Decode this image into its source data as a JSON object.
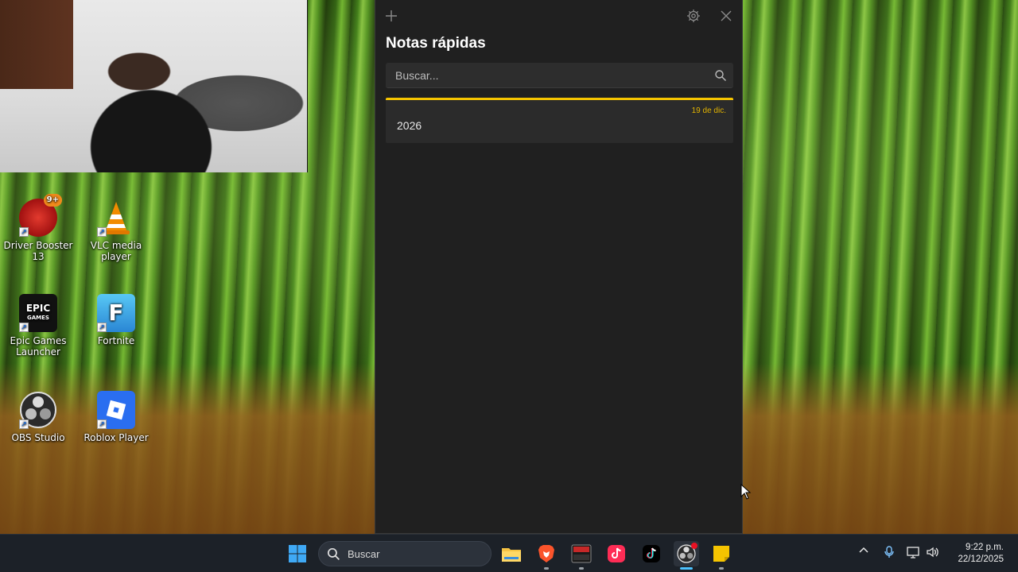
{
  "desktop": {
    "icons": [
      {
        "label": "Driver Booster 13",
        "badge": "9+",
        "color": "#c8201e"
      },
      {
        "label": "VLC media player",
        "color": "#f08a00"
      },
      {
        "label": "Epic Games Launcher",
        "color": "#111111",
        "glyph": "EPIC"
      },
      {
        "label": "Fortnite",
        "color": "#38a8e8",
        "glyph": "F"
      },
      {
        "label": "OBS Studio",
        "color": "#222222"
      },
      {
        "label": "Roblox Player",
        "color": "#2a6ef0"
      }
    ]
  },
  "sticky_notes": {
    "title": "Notas rápidas",
    "search_placeholder": "Buscar...",
    "accent_color": "#f5c400",
    "notes": [
      {
        "text": "2026",
        "date": "19 de dic."
      }
    ]
  },
  "taskbar": {
    "search_label": "Buscar",
    "pinned": [
      "start-icon",
      "file-explorer-icon",
      "brave-icon",
      "voicemeeter-icon",
      "tiktok-studio-icon",
      "tiktok-icon",
      "obs-icon",
      "sticky-notes-icon"
    ],
    "clock_time": "9:22 p.m.",
    "clock_date": "22/12/2025"
  }
}
